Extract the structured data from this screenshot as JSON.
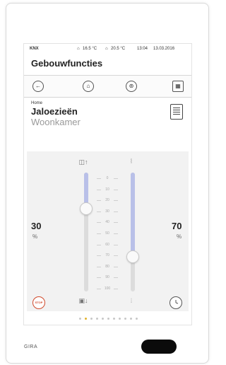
{
  "status": {
    "system": "KNX",
    "temp_indoor": "16.5 °C",
    "temp_outdoor": "20.5 °C",
    "time": "13:04",
    "date": "13.03.2016"
  },
  "header": {
    "title": "Gebouwfuncties"
  },
  "nav": {
    "buttons": [
      {
        "icon": "back-arrow-icon",
        "glyph": "←"
      },
      {
        "icon": "home-icon",
        "glyph": "⌂"
      },
      {
        "icon": "favorite-icon",
        "glyph": "⊚"
      },
      {
        "icon": "grid-icon",
        "glyph": "▦"
      }
    ]
  },
  "breadcrumb": {
    "home": "Home"
  },
  "function": {
    "name": "Jaloezieën",
    "room": "Woonkamer"
  },
  "controls": {
    "position": {
      "value": "30",
      "unit": "%"
    },
    "slat": {
      "value": "70",
      "unit": "%"
    },
    "scale": [
      "0",
      "10",
      "20",
      "30",
      "40",
      "50",
      "60",
      "70",
      "80",
      "90",
      "100"
    ],
    "stop_label": "STOP",
    "up_glyph": "◫↑",
    "down_glyph": "▣↓",
    "slat_open_glyph": "⦚",
    "slat_closed_glyph": "⦙"
  },
  "pagination": {
    "count": 11,
    "active": 1
  },
  "device": {
    "brand": "GIRA"
  },
  "colors": {
    "fill": "#b9c0e8",
    "stop": "#d04a2c",
    "active_dot": "#e2b22a"
  }
}
